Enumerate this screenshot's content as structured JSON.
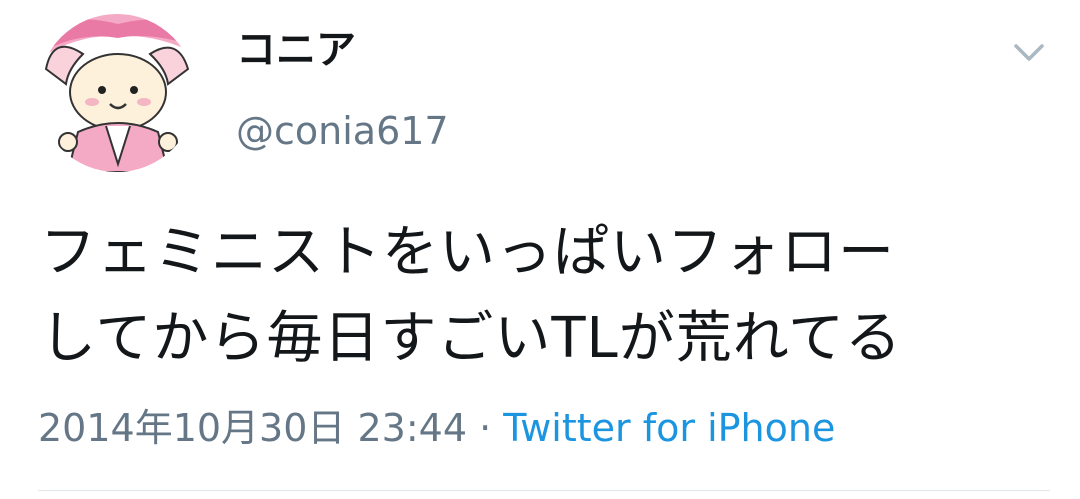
{
  "user": {
    "display_name": "コニア",
    "username": "@conia617"
  },
  "tweet": {
    "lines": [
      "フェミニストをいっぱいフォロー",
      "してから毎日すごいTLが荒れてる"
    ],
    "timestamp": "2014年10月30日 23:44",
    "separator": "·",
    "source": "Twitter for iPhone"
  },
  "icons": {
    "menu": "chevron-down-icon",
    "avatar": "cartoon-cat-avatar"
  },
  "colors": {
    "text_primary": "#14171a",
    "text_secondary": "#657786",
    "link": "#1b95e0",
    "divider": "#e1e8ed"
  }
}
